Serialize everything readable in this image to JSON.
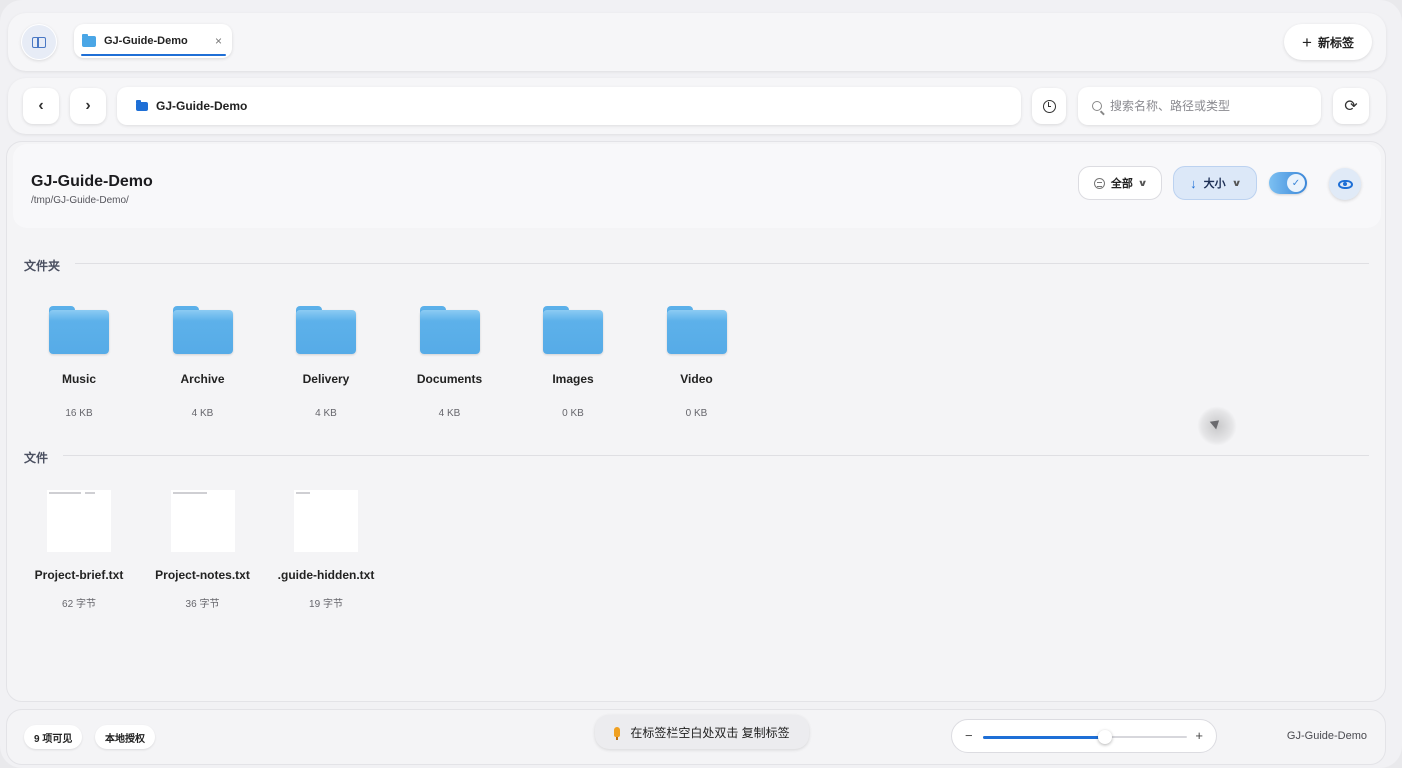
{
  "tabbar": {
    "tab_label": "GJ-Guide-Demo",
    "tab_close": "×",
    "new_tab_label": "新标签",
    "new_tab_plus": "+"
  },
  "addressbar": {
    "back": "‹",
    "forward": "›",
    "path": "GJ-Guide-Demo",
    "search_placeholder": "搜索名称、路径或类型",
    "sync_glyph": "⟳"
  },
  "header": {
    "title": "GJ-Guide-Demo",
    "path": "/tmp/GJ-Guide-Demo/",
    "filter_label": "全部",
    "sort_label": "大小",
    "sort_arrow": "↓",
    "toggle_on": true,
    "toggle_check": "✓"
  },
  "sections": {
    "folders_label": "文件夹",
    "files_label": "文件"
  },
  "folders": [
    {
      "name": "Music",
      "size": "16 KB"
    },
    {
      "name": "Archive",
      "size": "4 KB"
    },
    {
      "name": "Delivery",
      "size": "4 KB"
    },
    {
      "name": "Documents",
      "size": "4 KB"
    },
    {
      "name": "Images",
      "size": "0 KB"
    },
    {
      "name": "Video",
      "size": "0 KB"
    }
  ],
  "files": [
    {
      "name": "Project-brief.txt",
      "size": "62 字节"
    },
    {
      "name": "Project-notes.txt",
      "size": "36 字节"
    },
    {
      "name": ".guide-hidden.txt",
      "size": "19 字节"
    }
  ],
  "status": {
    "visible_count": "9 项可见",
    "license": "本地授权",
    "tip": "在标签栏空白处双击 复制标签",
    "zoom_minus": "−",
    "zoom_plus": "+",
    "zoom_level": 0.6,
    "current_folder": "GJ-Guide-Demo"
  },
  "colors": {
    "accent": "#1e6fd6",
    "folder": "#5db1ea"
  }
}
